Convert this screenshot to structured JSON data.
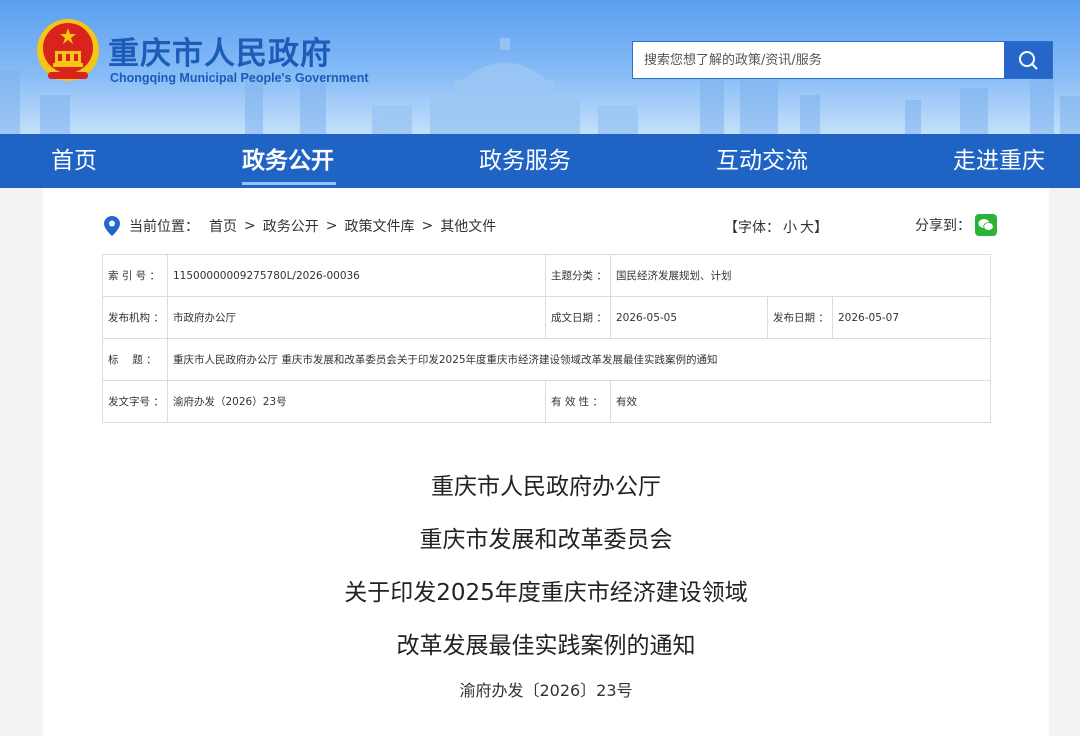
{
  "header": {
    "site_title": "重庆市人民政府",
    "site_subtitle": "Chongqing Municipal People's Government",
    "search_placeholder": "搜索您想了解的政策/资讯/服务",
    "emblem_icon": "national-emblem-icon",
    "search_icon": "search-icon"
  },
  "nav": {
    "items": [
      {
        "label": "首页"
      },
      {
        "label": "政务公开"
      },
      {
        "label": "政务服务"
      },
      {
        "label": "互动交流"
      },
      {
        "label": "走进重庆"
      }
    ],
    "active": "政务公开"
  },
  "breadcrumb": {
    "label": "当前位置：",
    "items": [
      "首页",
      "政务公开",
      "政策文件库",
      "其他文件"
    ],
    "separator": ">"
  },
  "font_ctrl": {
    "open": "【字体：",
    "small": "小",
    "large": "大",
    "close": "】"
  },
  "share": {
    "label": "分享到：",
    "icon": "wechat-icon"
  },
  "meta": {
    "index_key": "索 引 号 ：",
    "index_val": "11500000009275780L/2026-00036",
    "topic_key": "主题分类 ：",
    "topic_val": "国民经济发展规划、计划",
    "issuer_key": "发布机构 ：",
    "issuer_val": "市政府办公厅",
    "created_key": "成文日期 ：",
    "created_val": "2026-05-05",
    "published_key": "发布日期 ：",
    "published_val": "2026-05-07",
    "title_key": "标　  题 ：",
    "title_val": "重庆市人民政府办公厅 重庆市发展和改革委员会关于印发2025年度重庆市经济建设领域改革发展最佳实践案例的通知",
    "docno_key": "发文字号 ：",
    "docno_val": "渝府办发（2026）23号",
    "valid_key": "有 效 性 ：",
    "valid_val": "有效"
  },
  "document": {
    "lines": [
      "重庆市人民政府办公厅",
      "重庆市发展和改革委员会",
      "关于印发2025年度重庆市经济建设领域",
      "改革发展最佳实践案例的通知"
    ],
    "doc_number": "渝府办发〔2026〕23号"
  },
  "colors": {
    "nav_bg": "#1f63c5",
    "title_blue": "#1c5bb8",
    "emblem_red": "#d8241c",
    "emblem_gold": "#f5c518",
    "wechat_green": "#2bb336"
  }
}
